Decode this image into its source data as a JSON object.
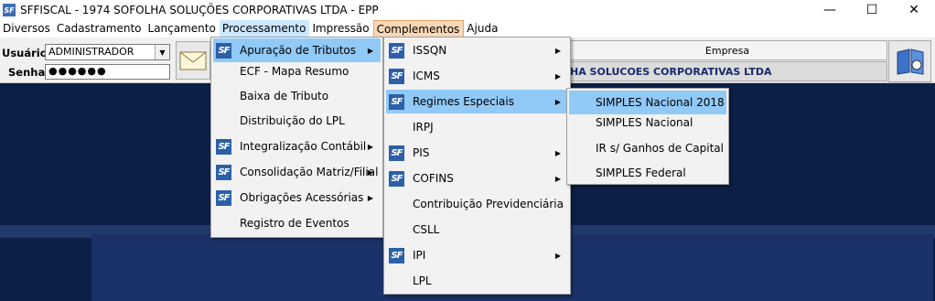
{
  "window": {
    "title": "SFFISCAL - 1974 SOFOLHA SOLUÇÕES CORPORATIVAS LTDA - EPP",
    "app_icon": "SF",
    "min": "—",
    "max": "☐",
    "close": "✕"
  },
  "menubar": [
    "Diversos",
    "Cadastramento",
    "Lançamento",
    "Processamento",
    "Impressão",
    "Complementos",
    "Ajuda"
  ],
  "form": {
    "usuario_label": "Usuário:",
    "usuario_value": "ADMINISTRADOR",
    "senha_label": "Senha:",
    "senha_value": "●●●●●●",
    "empresa_label": "Empresa",
    "empresa_value": "HA SOLUCOES CORPORATIVAS LTDA"
  },
  "menu_processamento": [
    {
      "label": "Apuração de Tributos",
      "icon": "SF",
      "arrow": "▶"
    },
    {
      "label": "ECF - Mapa Resumo",
      "icon": "",
      "arrow": ""
    },
    {
      "label": "Baixa de Tributo",
      "icon": "",
      "arrow": ""
    },
    {
      "label": "Distribuição do LPL",
      "icon": "",
      "arrow": ""
    },
    {
      "label": "Integralização Contábil",
      "icon": "SF",
      "arrow": "▶"
    },
    {
      "label": "Consolidação Matriz/Filial",
      "icon": "SF",
      "arrow": "▶"
    },
    {
      "label": "Obrigações Acessórias",
      "icon": "SF",
      "arrow": "▶"
    },
    {
      "label": "Registro de Eventos",
      "icon": "",
      "arrow": ""
    }
  ],
  "menu_apuracao": [
    {
      "label": "ISSQN",
      "icon": "SF",
      "arrow": "▶"
    },
    {
      "label": "ICMS",
      "icon": "SF",
      "arrow": "▶"
    },
    {
      "label": "Regimes Especiais",
      "icon": "SF",
      "arrow": "▶"
    },
    {
      "label": "IRPJ",
      "icon": "",
      "arrow": ""
    },
    {
      "label": "PIS",
      "icon": "SF",
      "arrow": "▶"
    },
    {
      "label": "COFINS",
      "icon": "SF",
      "arrow": "▶"
    },
    {
      "label": "Contribuição Previdenciária",
      "icon": "",
      "arrow": ""
    },
    {
      "label": "CSLL",
      "icon": "",
      "arrow": ""
    },
    {
      "label": "IPI",
      "icon": "SF",
      "arrow": "▶"
    },
    {
      "label": "LPL",
      "icon": "",
      "arrow": ""
    }
  ],
  "menu_regimes": [
    {
      "label": "SIMPLES Nacional 2018"
    },
    {
      "label": "SIMPLES Nacional"
    },
    {
      "label": "IR s/ Ganhos de Capital"
    },
    {
      "label": "SIMPLES Federal"
    }
  ]
}
